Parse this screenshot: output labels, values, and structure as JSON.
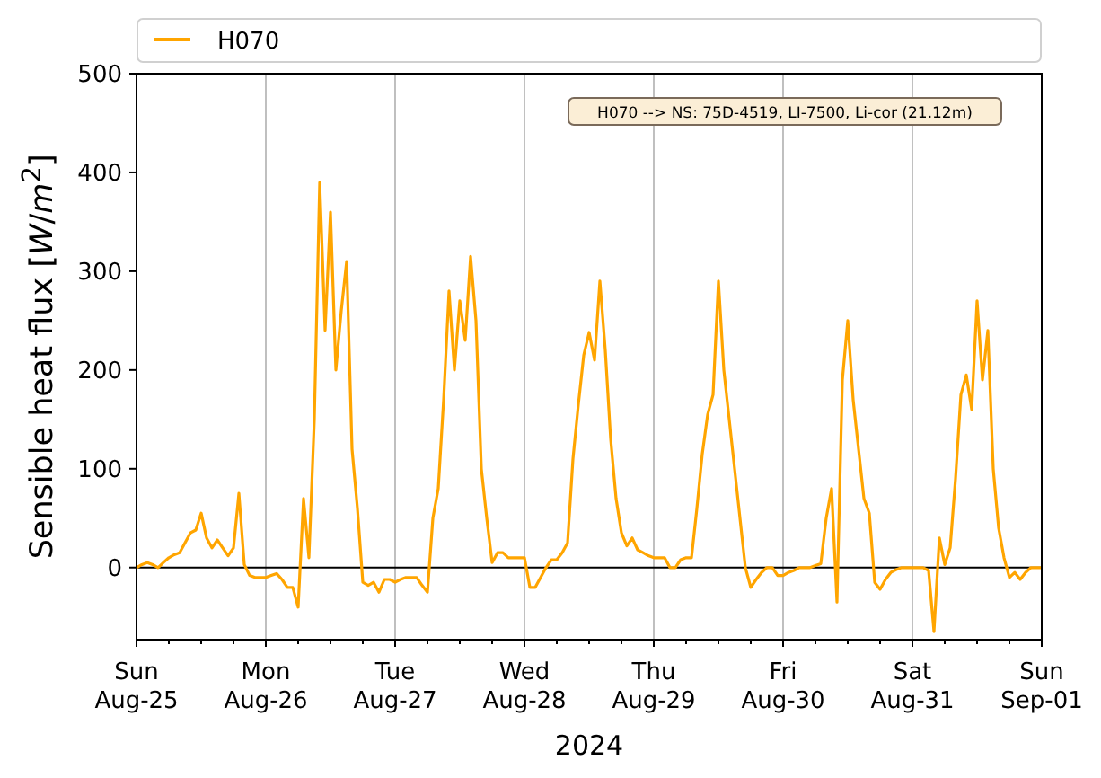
{
  "annotation": "H070 --> NS: 75D-4519, LI-7500, Li-cor (21.12m)",
  "chart_data": {
    "type": "line",
    "xlabel": "2024",
    "ylabel": "Sensible heat flux [*W*/*m*$^{2}$]",
    "categories": [
      "Sun\nAug-25",
      null,
      null,
      null,
      null,
      null,
      null,
      null,
      null,
      null,
      null,
      null,
      null,
      null,
      null,
      null,
      null,
      null,
      null,
      null,
      null,
      null,
      null,
      null,
      "Mon\nAug-26",
      null,
      null,
      null,
      null,
      null,
      null,
      null,
      null,
      null,
      null,
      null,
      null,
      null,
      null,
      null,
      null,
      null,
      null,
      null,
      null,
      null,
      null,
      null,
      "Tue\nAug-27",
      null,
      null,
      null,
      null,
      null,
      null,
      null,
      null,
      null,
      null,
      null,
      null,
      null,
      null,
      null,
      null,
      null,
      null,
      null,
      null,
      null,
      null,
      null,
      "Wed\nAug-28",
      null,
      null,
      null,
      null,
      null,
      null,
      null,
      null,
      null,
      null,
      null,
      null,
      null,
      null,
      null,
      null,
      null,
      null,
      null,
      null,
      null,
      null,
      null,
      "Thu\nAug-29",
      null,
      null,
      null,
      null,
      null,
      null,
      null,
      null,
      null,
      null,
      null,
      null,
      null,
      null,
      null,
      null,
      null,
      null,
      null,
      null,
      null,
      null,
      null,
      "Fri\nAug-30",
      null,
      null,
      null,
      null,
      null,
      null,
      null,
      null,
      null,
      null,
      null,
      null,
      null,
      null,
      null,
      null,
      null,
      null,
      null,
      null,
      null,
      null,
      null,
      "Sat\nAug-31",
      null,
      null,
      null,
      null,
      null,
      null,
      null,
      null,
      null,
      null,
      null,
      null,
      null,
      null,
      null,
      null,
      null,
      null,
      null,
      null,
      null,
      null,
      null,
      "Sun\nSep-01"
    ],
    "series": [
      {
        "name": "H070",
        "color": "#ffa500",
        "values": [
          0,
          3,
          5,
          3,
          0,
          5,
          10,
          13,
          15,
          25,
          35,
          38,
          55,
          30,
          20,
          28,
          20,
          12,
          20,
          75,
          3,
          -8,
          -10,
          -10,
          -10,
          -8,
          -6,
          -12,
          -20,
          -20,
          -40,
          70,
          10,
          150,
          390,
          240,
          360,
          200,
          260,
          310,
          120,
          60,
          -15,
          -18,
          -15,
          -25,
          -12,
          -12,
          -15,
          -12,
          -10,
          -10,
          -10,
          -18,
          -25,
          50,
          80,
          170,
          280,
          200,
          270,
          230,
          315,
          250,
          100,
          50,
          5,
          15,
          15,
          10,
          10,
          10,
          10,
          -20,
          -20,
          -10,
          0,
          8,
          8,
          15,
          25,
          110,
          165,
          215,
          238,
          210,
          290,
          220,
          130,
          70,
          35,
          22,
          30,
          18,
          15,
          12,
          10,
          10,
          10,
          0,
          0,
          8,
          10,
          10,
          60,
          115,
          155,
          175,
          290,
          200,
          150,
          100,
          50,
          0,
          -20,
          -12,
          -5,
          0,
          0,
          -8,
          -8,
          -5,
          -3,
          0,
          0,
          0,
          2,
          4,
          50,
          80,
          -35,
          190,
          250,
          170,
          120,
          70,
          55,
          -15,
          -22,
          -12,
          -5,
          -2,
          0,
          0,
          0,
          0,
          0,
          -3,
          -65,
          30,
          3,
          20,
          90,
          175,
          195,
          160,
          270,
          190,
          240,
          100,
          40,
          10,
          -10,
          -5,
          -12,
          -5,
          0,
          0,
          0
        ]
      }
    ],
    "ylim": [
      -73,
      500
    ],
    "yticks": [
      0,
      100,
      200,
      300,
      400,
      500
    ]
  }
}
